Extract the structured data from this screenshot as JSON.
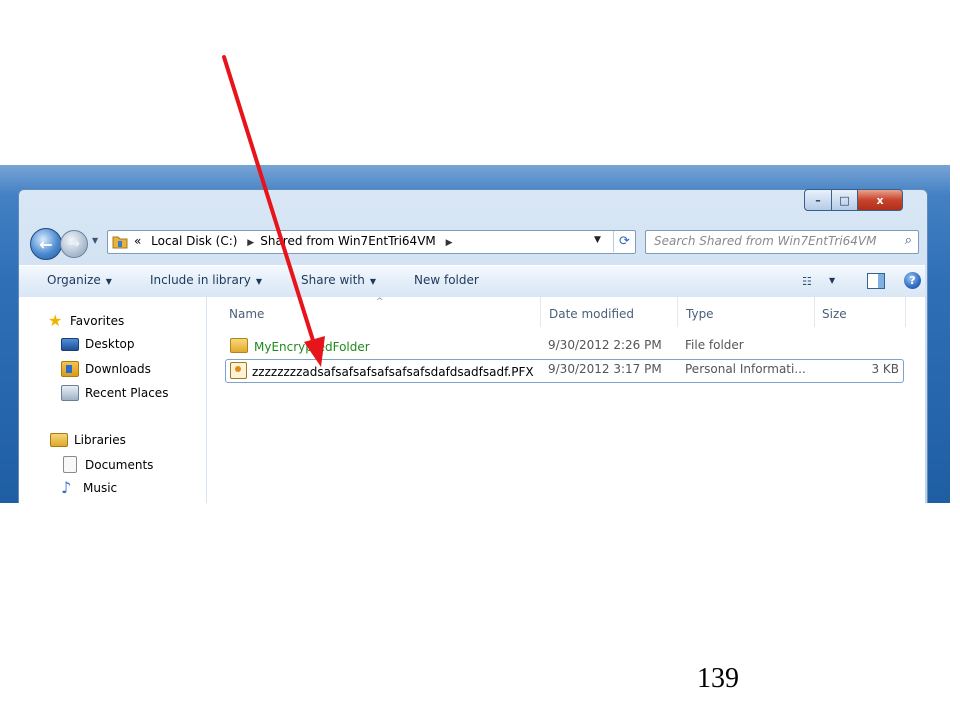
{
  "window": {
    "caption_buttons": {
      "minimize": "–",
      "maximize": "□",
      "close": "x"
    }
  },
  "address_bar": {
    "back_glyph": "←",
    "forward_glyph": "→",
    "history_glyph": "▼",
    "overflow": "«",
    "crumbs": [
      "Local Disk (C:)",
      "Shared from Win7EntTri64VM"
    ],
    "separator": "▶",
    "dropdown_glyph": "▼",
    "refresh_glyph": "⟳"
  },
  "search": {
    "placeholder": "Search Shared from Win7EntTri64VM",
    "icon": "search-icon"
  },
  "toolbar": {
    "organize": "Organize",
    "include_in_library": "Include in library",
    "share_with": "Share with",
    "new_folder": "New folder",
    "dropdown_glyph": "▼",
    "views_glyph": "☷",
    "help_glyph": "?"
  },
  "nav": {
    "favorites_header": "Favorites",
    "favorites": [
      "Desktop",
      "Downloads",
      "Recent Places"
    ],
    "libraries_header": "Libraries",
    "libraries": [
      "Documents",
      "Music"
    ]
  },
  "columns": {
    "name": "Name",
    "date_modified": "Date modified",
    "type": "Type",
    "size": "Size",
    "sort_glyph": "^"
  },
  "files": [
    {
      "name": "MyEncryptedFolder",
      "date_modified": "9/30/2012 2:26 PM",
      "type": "File folder",
      "size": ""
    },
    {
      "name": "zzzzzzzzadsafsafsafsafsafsafsdafdsadfsadf.PFX",
      "date_modified": "9/30/2012 3:17 PM",
      "type": "Personal Informati...",
      "size": "3 KB"
    }
  ],
  "colors": {
    "annotation_arrow": "#e8141b",
    "encrypted_folder_text": "#1f8a1f",
    "title_bar": "#2f6fb6"
  },
  "page_number": "139"
}
